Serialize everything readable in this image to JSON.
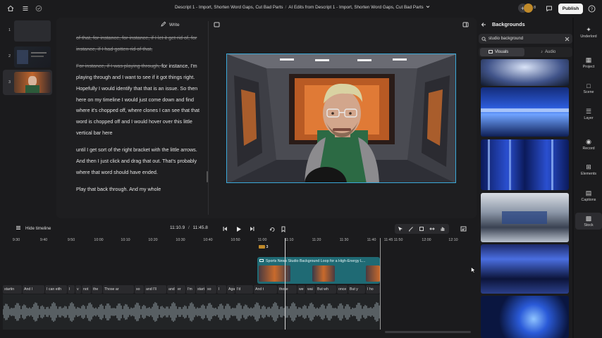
{
  "topbar": {
    "crumbs": [
      "Descript 1 - Import, Shorten Word Gaps, Cut Bad Parts",
      "AI Edits from Descript 1 - Import, Shorten Word Gaps, Cut Bad Parts"
    ],
    "crumb_sep": "/",
    "avatar_count": "8",
    "publish_label": "Publish"
  },
  "scenes": [
    {
      "num": "1"
    },
    {
      "num": "2"
    },
    {
      "num": "3"
    }
  ],
  "editor": {
    "write_label": "Write",
    "paragraphs": [
      {
        "parts": [
          {
            "t": "of that, for instance, for instance, if I let it get rid of, for instance, if I had gotten rid of that,",
            "s": true
          }
        ]
      },
      {
        "parts": [
          {
            "t": "For instance, if I was playing through, ",
            "s": true
          },
          {
            "t": "for instance, I'm playing through and I want to see if it got things right. Hopefully I would identify that that is an issue. So then here on my timeline I would just come down and find where it's chopped off, where clones I can see that that word is chopped off and I would hover over this little vertical bar here",
            "s": false
          }
        ]
      },
      {
        "parts": [
          {
            "t": "until I get sort of the right bracket with the little arrows. And then I just click and drag that out. That's probably where that word should have ended.",
            "s": false
          }
        ]
      },
      {
        "parts": [
          {
            "t": "Play that back through. And my whole",
            "s": false
          }
        ]
      }
    ]
  },
  "timeline": {
    "hide_label": "Hide timeline",
    "current_time": "11:10.9",
    "time_sep": "/",
    "total_time": "11:45.8",
    "ruler": [
      "9:30",
      "9:40",
      "9:50",
      "10:00",
      "10:10",
      "10:20",
      "10:30",
      "10:40",
      "10:50",
      "11:00",
      "11:10",
      "11:20",
      "11:30",
      "11:40",
      "11:45",
      "11:50",
      "12:00",
      "12:10"
    ],
    "layer_number": "3",
    "clip_title": "Sports News Studio Background Loop for a High-Energy L...",
    "words": [
      "startin",
      "And I",
      "I can eith",
      "I",
      "v",
      "not",
      "the",
      "Those ar",
      "so",
      "and I'll",
      "and",
      "er",
      "I'm",
      "start",
      "so",
      "I",
      "Agai",
      "I'd",
      "And t",
      "those",
      "we",
      "wai",
      "But wh",
      "once",
      "But y",
      "I ho"
    ]
  },
  "panel": {
    "title": "Backgrounds",
    "search_value": "studio background",
    "tabs": [
      "Visuals",
      "Audio"
    ]
  },
  "rail": [
    "Underlord",
    "Project",
    "Scene",
    "Layer",
    "Record",
    "Elements",
    "Captions",
    "Stock"
  ],
  "colors": {
    "accent": "#3aa9d9",
    "clip": "#1f6a74",
    "publish_bg": "#f3f3f3"
  }
}
